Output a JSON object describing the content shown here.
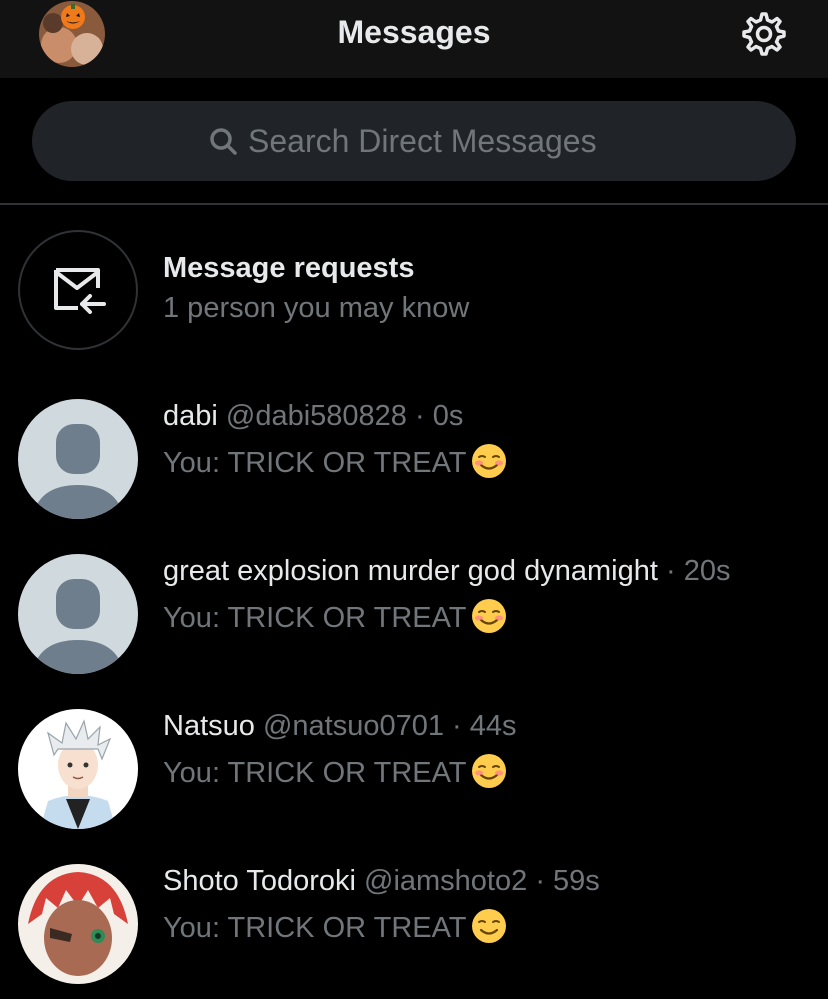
{
  "header": {
    "title": "Messages",
    "avatar_icon": "pumpkin-avatar",
    "settings_icon": "gear-icon"
  },
  "search": {
    "placeholder": "Search Direct Messages"
  },
  "requests": {
    "title": "Message requests",
    "subtitle": "1 person you may know"
  },
  "conversations": [
    {
      "name": "dabi",
      "handle": "@dabi580828",
      "time": "0s",
      "preview": "You: TRICK OR TREAT",
      "emoji": "smiling-face-icon"
    },
    {
      "name": "great explosion murder god dynamight",
      "handle": "",
      "time": "20s",
      "preview": "You: TRICK OR TREAT",
      "emoji": "smiling-face-icon"
    },
    {
      "name": "Natsuo",
      "handle": "@natsuo0701",
      "time": "44s",
      "preview": "You: TRICK OR TREAT",
      "emoji": "smiling-face-icon"
    },
    {
      "name": "Shoto Todoroki",
      "handle": "@iamshoto2",
      "time": "59s",
      "preview": "You: TRICK OR TREAT",
      "emoji": "smiling-face-icon"
    }
  ],
  "separator": "·",
  "colors": {
    "background": "#000000",
    "header_bg": "#121212",
    "search_bg": "#202327",
    "primary_text": "#e7e9ea",
    "secondary_text": "#71767b",
    "divider": "#2f3336",
    "default_avatar_bg": "#cfd9de",
    "default_avatar_fg": "#6e7e8c"
  }
}
